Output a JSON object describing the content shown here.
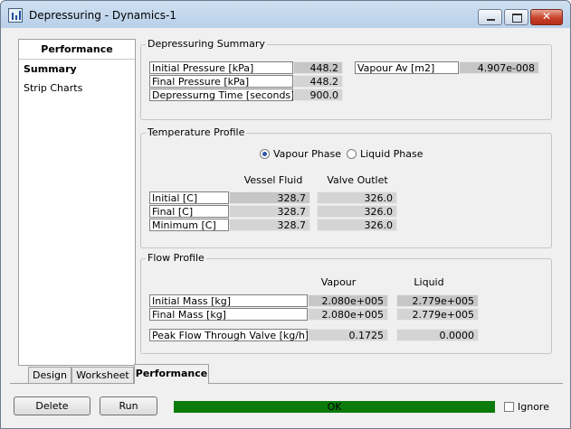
{
  "window": {
    "title": "Depressuring - Dynamics-1",
    "min_icon": "minimize-icon",
    "max_icon": "maximize-icon",
    "close_glyph": "✕"
  },
  "nav": {
    "title": "Performance",
    "items": [
      "Summary",
      "Strip Charts"
    ]
  },
  "summary": {
    "title": "Depressuring Summary",
    "rows": [
      {
        "label": "Initial Pressure [kPa]",
        "value": "448.2"
      },
      {
        "label": "Final Pressure [kPa]",
        "value": "448.2"
      },
      {
        "label": "Depressurng Time [seconds]",
        "value": "900.0"
      }
    ],
    "vapour_av": {
      "label": "Vapour Av [m2]",
      "value": "4.907e-008"
    }
  },
  "temperature": {
    "title": "Temperature Profile",
    "radio_vapour": "Vapour Phase",
    "radio_liquid": "Liquid Phase",
    "col_vessel": "Vessel Fluid",
    "col_valve": "Valve Outlet",
    "rows": [
      {
        "label": "Initial [C]",
        "vessel": "328.7",
        "valve": "326.0"
      },
      {
        "label": "Final [C]",
        "vessel": "328.7",
        "valve": "326.0"
      },
      {
        "label": "Minimum [C]",
        "vessel": "328.7",
        "valve": "326.0"
      }
    ]
  },
  "flow": {
    "title": "Flow Profile",
    "col_vapour": "Vapour",
    "col_liquid": "Liquid",
    "rows": [
      {
        "label": "Initial Mass [kg]",
        "vapour": "2.080e+005",
        "liquid": "2.779e+005"
      },
      {
        "label": "Final Mass [kg]",
        "vapour": "2.080e+005",
        "liquid": "2.779e+005"
      }
    ],
    "peak": {
      "label": "Peak Flow Through Valve [kg/h]",
      "vapour": "0.1725",
      "liquid": "0.0000"
    }
  },
  "tabs": [
    "Design",
    "Worksheet",
    "Performance"
  ],
  "footer": {
    "delete": "Delete",
    "run": "Run",
    "status": "OK",
    "ignore": "Ignore"
  },
  "colors": {
    "status_ok": "#0b7b0b"
  }
}
